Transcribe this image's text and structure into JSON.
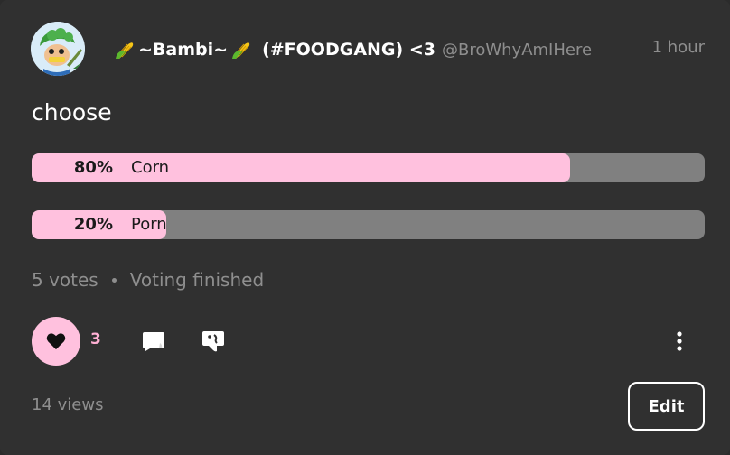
{
  "post": {
    "author_name": "~Bambi~",
    "author_suffix": "(#FOODGANG) <3",
    "handle": "@BroWhyAmIHere",
    "time": "1 hour",
    "text": "choose"
  },
  "poll": {
    "options": [
      {
        "percent_label": "80%",
        "label": "Corn",
        "fraction": 0.8
      },
      {
        "percent_label": "20%",
        "label": "Porn",
        "fraction": 0.2
      }
    ],
    "votes": "5 votes",
    "status": "Voting finished"
  },
  "actions": {
    "like_count": "3",
    "views": "14 views",
    "edit_label": "Edit"
  },
  "icons": {
    "like": "heart-icon",
    "comment": "comment-bubble-icon",
    "share": "share-icon",
    "more": "more-vertical-icon",
    "name_emoji": "corn-icon"
  },
  "colors": {
    "card_bg": "#303030",
    "accent_pink": "#ffc1de",
    "poll_track": "#808080",
    "muted_text": "#8e8e8e"
  }
}
